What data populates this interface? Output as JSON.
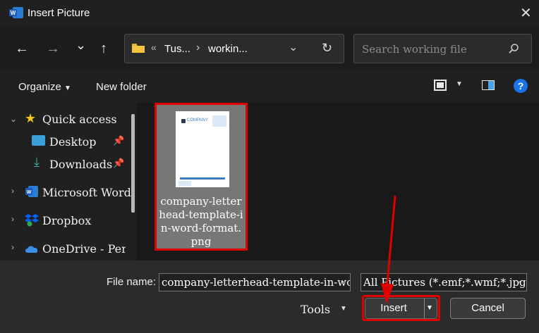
{
  "window": {
    "title": "Insert Picture",
    "close": "✕"
  },
  "nav": {
    "back": "←",
    "forward": "→",
    "recent": "⌄",
    "up": "↑",
    "breadcrumb": [
      "Tus...",
      "workin..."
    ],
    "overflow": "«",
    "separator": "›",
    "refresh": "↻",
    "search_placeholder": "Search working file"
  },
  "toolbar": {
    "organize": "Organize",
    "new_folder": "New folder",
    "help": "?"
  },
  "sidebar": {
    "items": [
      {
        "label": "Quick access",
        "icon": "star-icon"
      },
      {
        "label": "Desktop",
        "icon": "desktop-icon"
      },
      {
        "label": "Downloads",
        "icon": "download-icon"
      },
      {
        "label": "Microsoft Word",
        "icon": "word-icon"
      },
      {
        "label": "Dropbox",
        "icon": "dropbox-icon"
      },
      {
        "label": "OneDrive - Perso",
        "icon": "onedrive-icon"
      }
    ]
  },
  "file": {
    "name": "company-letterhead-template-in-word-format.png",
    "name_lines": [
      "company-letter",
      "head-template-i",
      "n-word-format.",
      "png"
    ],
    "thumb_text": "COMPANY"
  },
  "footer": {
    "file_name_label": "File name:",
    "file_name_value": "company-letterhead-template-in-wo",
    "filter_value": "All Pictures (*.emf;*.wmf;*.jpg;*.j",
    "tools": "Tools",
    "insert": "Insert",
    "cancel": "Cancel"
  },
  "colors": {
    "highlight": "#e00000",
    "accent": "#0078d4"
  }
}
